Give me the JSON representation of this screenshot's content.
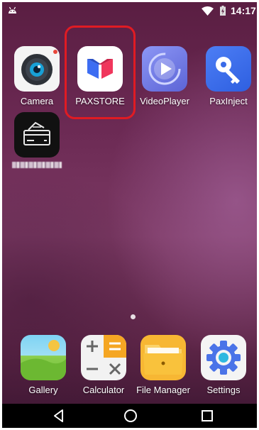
{
  "status_bar": {
    "time": "14:17",
    "icons": [
      "android-icon",
      "wifi-icon",
      "battery-charging-icon"
    ]
  },
  "apps": {
    "camera": {
      "label": "Camera",
      "icon": "camera-icon"
    },
    "paxstore": {
      "label": "PAXSTORE",
      "icon": "paxstore-logo-icon",
      "highlighted": true
    },
    "videoplayer": {
      "label": "VideoPlayer",
      "icon": "play-icon"
    },
    "paxinject": {
      "label": "PaxInject",
      "icon": "key-icon"
    },
    "payment": {
      "label": "",
      "icon": "card-payment-icon"
    }
  },
  "dock": {
    "gallery": {
      "label": "Gallery",
      "icon": "gallery-icon"
    },
    "calculator": {
      "label": "Calculator",
      "icon": "calculator-icon"
    },
    "file_manager": {
      "label": "File Manager",
      "icon": "folder-icon"
    },
    "settings": {
      "label": "Settings",
      "icon": "gear-icon"
    }
  },
  "nav_bar": {
    "buttons": [
      "back-icon",
      "home-icon",
      "recents-icon"
    ]
  },
  "colors": {
    "highlight": "#e01b23",
    "wallpaper": "#6c2a54"
  }
}
